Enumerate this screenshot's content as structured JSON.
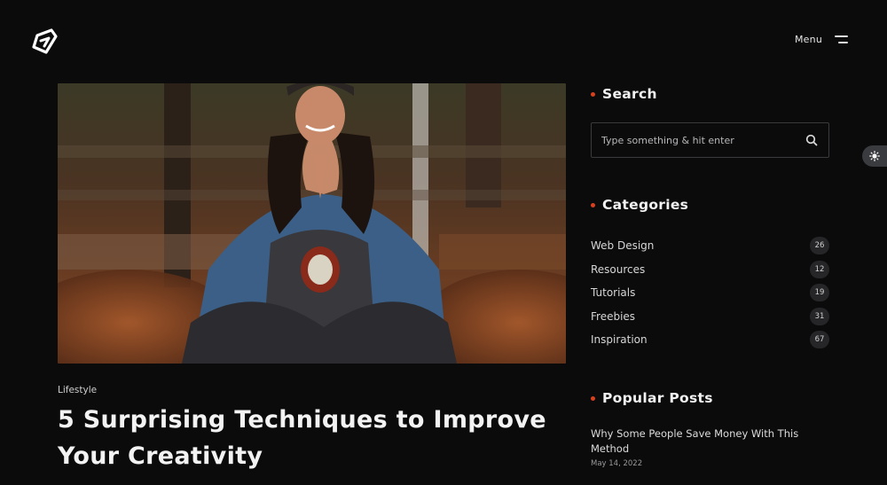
{
  "header": {
    "logo_icon": "brand-logo-icon",
    "menu_label": "Menu",
    "menu_icon": "hamburger-icon"
  },
  "post": {
    "category": "Lifestyle",
    "title": "5 Surprising Techniques to Improve Your Creativity"
  },
  "sidebar": {
    "search": {
      "title": "Search",
      "placeholder": "Type something & hit enter",
      "icon": "search-icon"
    },
    "categories": {
      "title": "Categories",
      "items": [
        {
          "name": "Web Design",
          "count": "26"
        },
        {
          "name": "Resources",
          "count": "12"
        },
        {
          "name": "Tutorials",
          "count": "19"
        },
        {
          "name": "Freebies",
          "count": "31"
        },
        {
          "name": "Inspiration",
          "count": "67"
        }
      ]
    },
    "popular": {
      "title": "Popular Posts",
      "post_title": "Why Some People Save Money With This Method",
      "post_date": "May 14, 2022"
    }
  },
  "floating": {
    "icon": "theme-toggle-icon"
  },
  "colors": {
    "accent": "#d8411e",
    "background": "#0b0b0c",
    "badge": "#262628"
  }
}
